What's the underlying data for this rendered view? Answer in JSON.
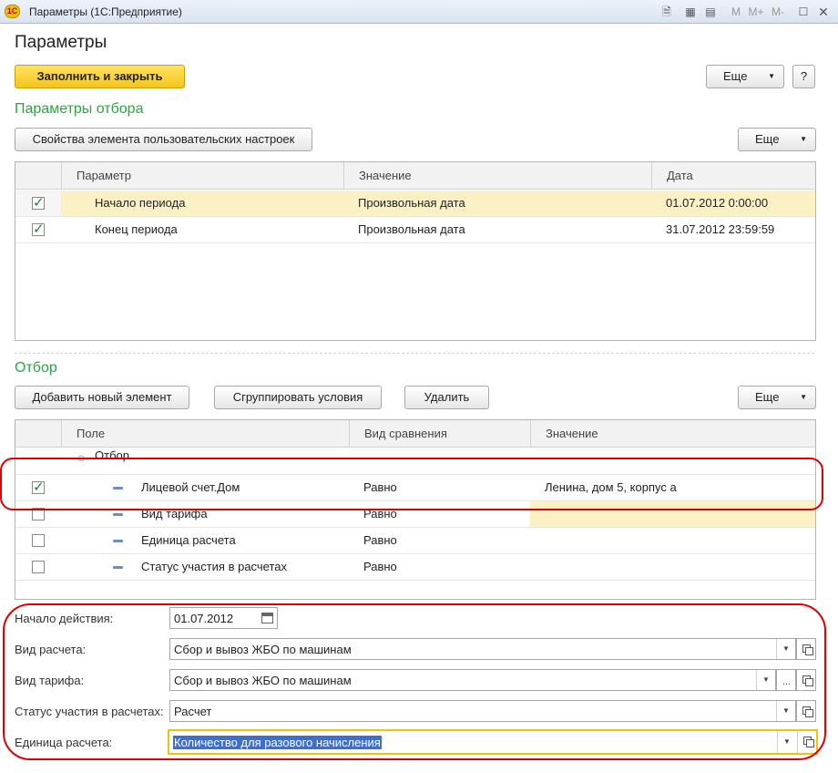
{
  "window": {
    "icon_text": "1С",
    "title": "Параметры  (1С:Предприятие)",
    "controls": [
      "M",
      "M+",
      "M-"
    ]
  },
  "page_title": "Параметры",
  "toolbar": {
    "fill_close_label": "Заполнить и закрыть",
    "more_label": "Еще",
    "help_label": "?"
  },
  "params_section": {
    "title": "Параметры отбора",
    "props_button": "Свойства элемента пользовательских настроек",
    "more_label": "Еще",
    "columns": [
      "Параметр",
      "Значение",
      "Дата"
    ],
    "rows": [
      {
        "checked": true,
        "param": "Начало периода",
        "value": "Произвольная дата",
        "date": "01.07.2012 0:00:00",
        "selected": true
      },
      {
        "checked": true,
        "param": "Конец периода",
        "value": "Произвольная дата",
        "date": "31.07.2012 23:59:59",
        "selected": false
      }
    ]
  },
  "filter_section": {
    "title": "Отбор",
    "add_button": "Добавить новый элемент",
    "group_button": "Сгруппировать условия",
    "delete_button": "Удалить",
    "more_label": "Еще",
    "columns": [
      "Поле",
      "Вид сравнения",
      "Значение"
    ],
    "group_label": "Отбор",
    "rows": [
      {
        "checked": true,
        "field": "Лицевой счет.Дом",
        "comparison": "Равно",
        "value": "Ленина, дом 5, корпус а"
      },
      {
        "checked": false,
        "field": "Вид тарифа",
        "comparison": "Равно",
        "value": ""
      },
      {
        "checked": false,
        "field": "Единица расчета",
        "comparison": "Равно",
        "value": ""
      },
      {
        "checked": false,
        "field": "Статус участия в расчетах",
        "comparison": "Равно",
        "value": ""
      }
    ]
  },
  "form": {
    "start_label": "Начало действия:",
    "start_value": "01.07.2012",
    "calc_type_label": "Вид расчета:",
    "calc_type_value": "Сбор и вывоз ЖБО по машинам",
    "tariff_label": "Вид тарифа:",
    "tariff_value": "Сбор и вывоз ЖБО по машинам",
    "status_label": "Статус участия в расчетах:",
    "status_value": "Расчет",
    "unit_label": "Единица расчета:",
    "unit_value": "Количество для разового начисления",
    "ellipsis": "..."
  },
  "colors": {
    "accent_green": "#2aa63f",
    "highlight_red": "#e00000",
    "selection_yellow": "#fbf1c4",
    "primary_button": "#f3c41c"
  }
}
